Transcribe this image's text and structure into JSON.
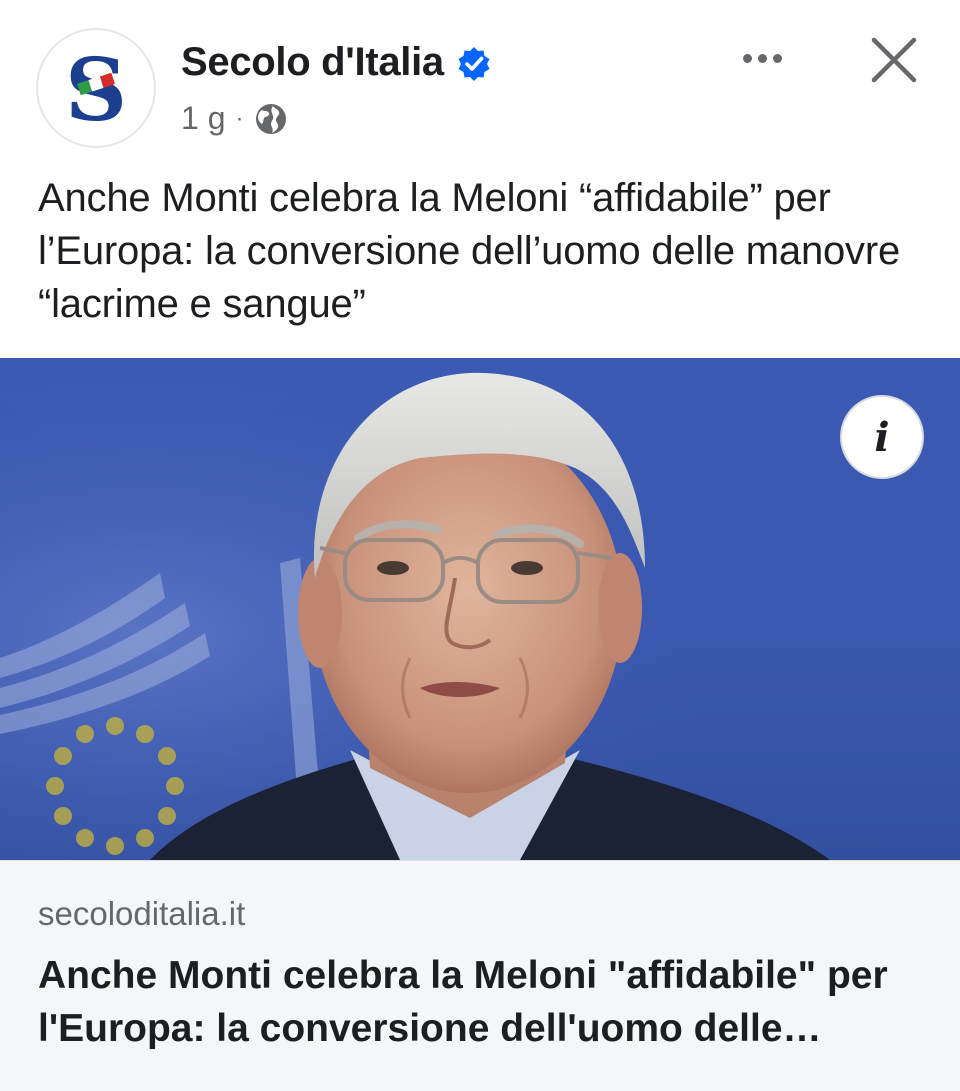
{
  "post": {
    "page_name": "Secolo d'Italia",
    "verified": true,
    "time": "1 g",
    "separator": "·",
    "audience_icon": "globe-icon",
    "more_icon": "more-horizontal-icon",
    "close_icon": "close-icon",
    "caption": "Anche Monti celebra la Meloni “affidabile” per l’Europa: la conversione dell’uomo delle manovre “lacrime e sangue”"
  },
  "avatar": {
    "letter": "S",
    "brand_color": "#1d3f8f"
  },
  "photo": {
    "info_icon": "info-icon",
    "info_glyph": "i"
  },
  "link_preview": {
    "domain": "secoloditalia.it",
    "title": "Anche Monti celebra la Meloni \"affidabile\" per l'Europa: la conversione dell'uomo delle manovre \"lacrime e sangue\""
  },
  "colors": {
    "verified_blue": "#0866ff",
    "text_primary": "#1c1e21",
    "text_secondary": "#65676b",
    "eu_blue": "#3b58b0",
    "preview_bg": "#f5f6f7"
  }
}
